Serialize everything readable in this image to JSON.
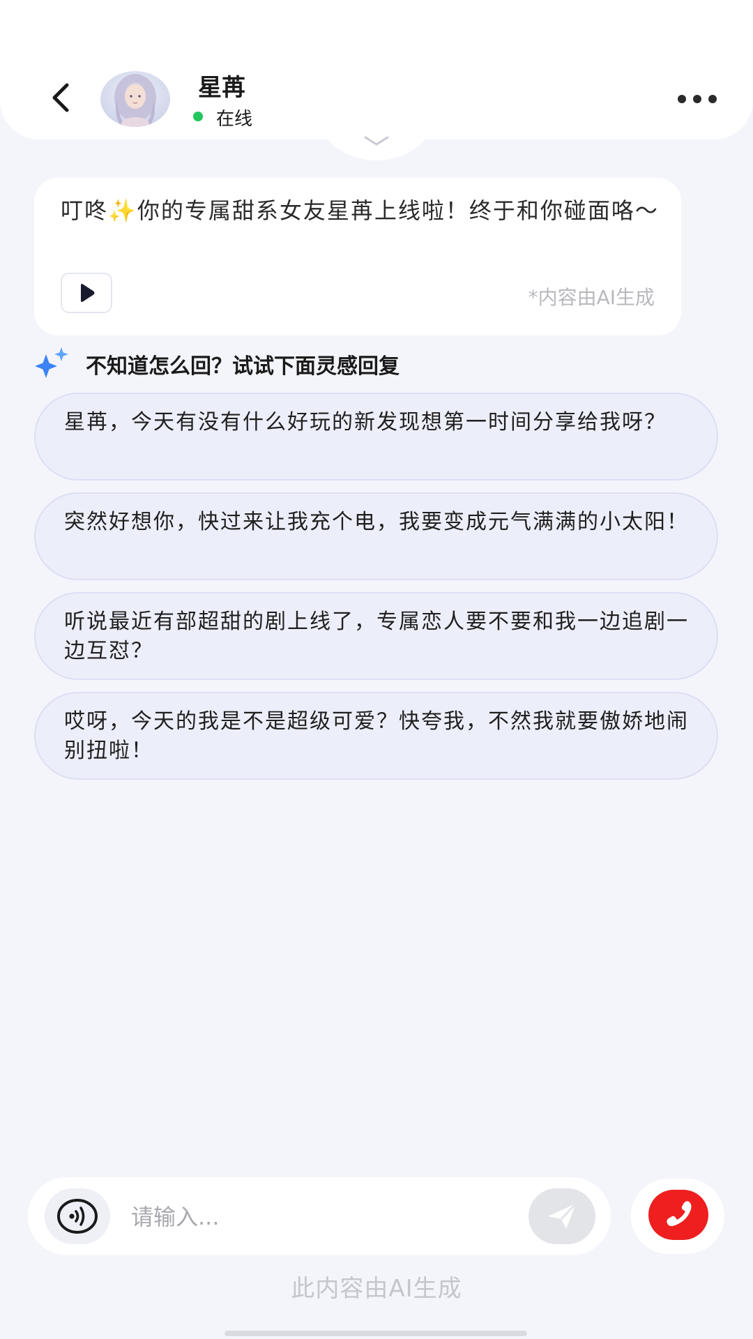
{
  "header": {
    "contact_name": "星苒",
    "status": "在线",
    "status_color": "#22c55e"
  },
  "message": {
    "text": "叮咚✨你的专属甜系女友星苒上线啦！终于和你碰面咯～",
    "ai_note": "*内容由AI生成"
  },
  "suggestions": {
    "title": "不知道怎么回？试试下面灵感回复",
    "items": [
      "星苒，今天有没有什么好玩的新发现想第一时间分享给我呀？",
      "突然好想你，快过来让我充个电，我要变成元气满满的小太阳！",
      "听说最近有部超甜的剧上线了，专属恋人要不要和我一边追剧一边互怼？",
      "哎呀，今天的我是不是超级可爱？快夸我，不然我就要傲娇地闹别扭啦！"
    ]
  },
  "input": {
    "placeholder": "请输入..."
  },
  "footer": {
    "note": "此内容由AI生成"
  },
  "colors": {
    "call_button": "#ef1f1f",
    "suggestion_bg": "#eceef9",
    "page_bg": "#f4f5fb"
  },
  "icons": {
    "back": "chevron-left-icon",
    "more": "more-dots-icon",
    "play": "play-icon",
    "sparkle": "sparkle-icon",
    "voice": "voice-icon",
    "send": "send-icon",
    "call": "phone-icon"
  }
}
